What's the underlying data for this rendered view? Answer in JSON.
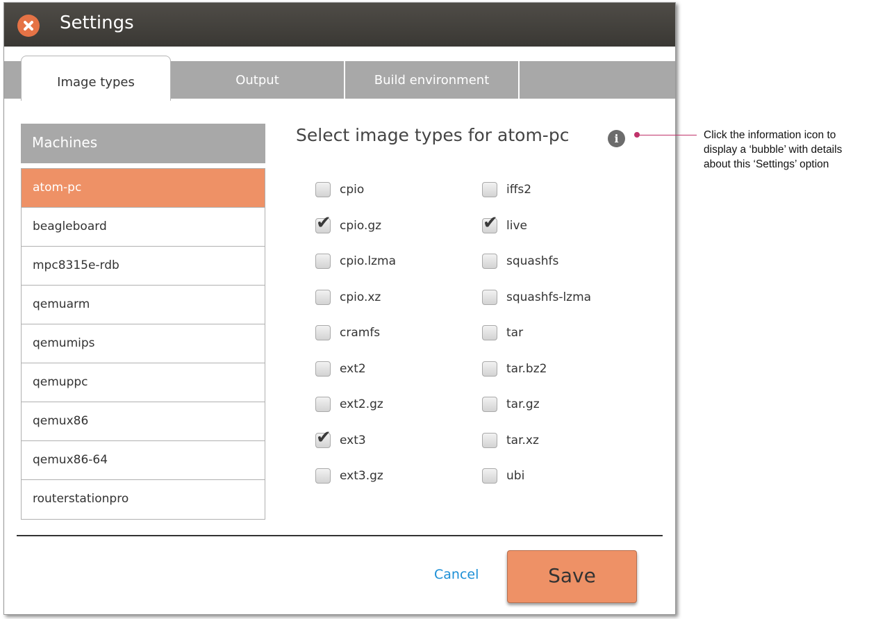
{
  "window": {
    "title": "Settings"
  },
  "tabs": [
    {
      "label": "Image types",
      "active": true
    },
    {
      "label": "Output",
      "active": false
    },
    {
      "label": "Build environment",
      "active": false
    }
  ],
  "machines": {
    "header": "Machines",
    "items": [
      {
        "label": "atom-pc",
        "selected": true
      },
      {
        "label": "beagleboard",
        "selected": false
      },
      {
        "label": "mpc8315e-rdb",
        "selected": false
      },
      {
        "label": "qemuarm",
        "selected": false
      },
      {
        "label": "qemumips",
        "selected": false
      },
      {
        "label": "qemuppc",
        "selected": false
      },
      {
        "label": "qemux86",
        "selected": false
      },
      {
        "label": "qemux86-64",
        "selected": false
      },
      {
        "label": "routerstationpro",
        "selected": false
      }
    ]
  },
  "image_types": {
    "title": "Select image types for atom-pc",
    "info_icon": "info-icon",
    "columns": [
      [
        {
          "label": "cpio",
          "checked": false
        },
        {
          "label": "cpio.gz",
          "checked": true
        },
        {
          "label": "cpio.lzma",
          "checked": false
        },
        {
          "label": "cpio.xz",
          "checked": false
        },
        {
          "label": "cramfs",
          "checked": false
        },
        {
          "label": "ext2",
          "checked": false
        },
        {
          "label": "ext2.gz",
          "checked": false
        },
        {
          "label": "ext3",
          "checked": true
        },
        {
          "label": "ext3.gz",
          "checked": false
        }
      ],
      [
        {
          "label": "iffs2",
          "checked": false
        },
        {
          "label": "live",
          "checked": true
        },
        {
          "label": "squashfs",
          "checked": false
        },
        {
          "label": "squashfs-lzma",
          "checked": false
        },
        {
          "label": "tar",
          "checked": false
        },
        {
          "label": "tar.bz2",
          "checked": false
        },
        {
          "label": "tar.gz",
          "checked": false
        },
        {
          "label": "tar.xz",
          "checked": false
        },
        {
          "label": "ubi",
          "checked": false
        }
      ]
    ]
  },
  "footer": {
    "cancel_label": "Cancel",
    "save_label": "Save"
  },
  "annotation": {
    "lines": [
      "Click the information icon to",
      "display a ‘bubble’ with details",
      "about this ‘Settings’ option"
    ]
  },
  "colors": {
    "accent": "#ee9166",
    "titlebar": "#3f3d39",
    "tab_inactive": "#a8a8a8",
    "link": "#1b8fd6",
    "annotation_line": "#c0326a"
  }
}
